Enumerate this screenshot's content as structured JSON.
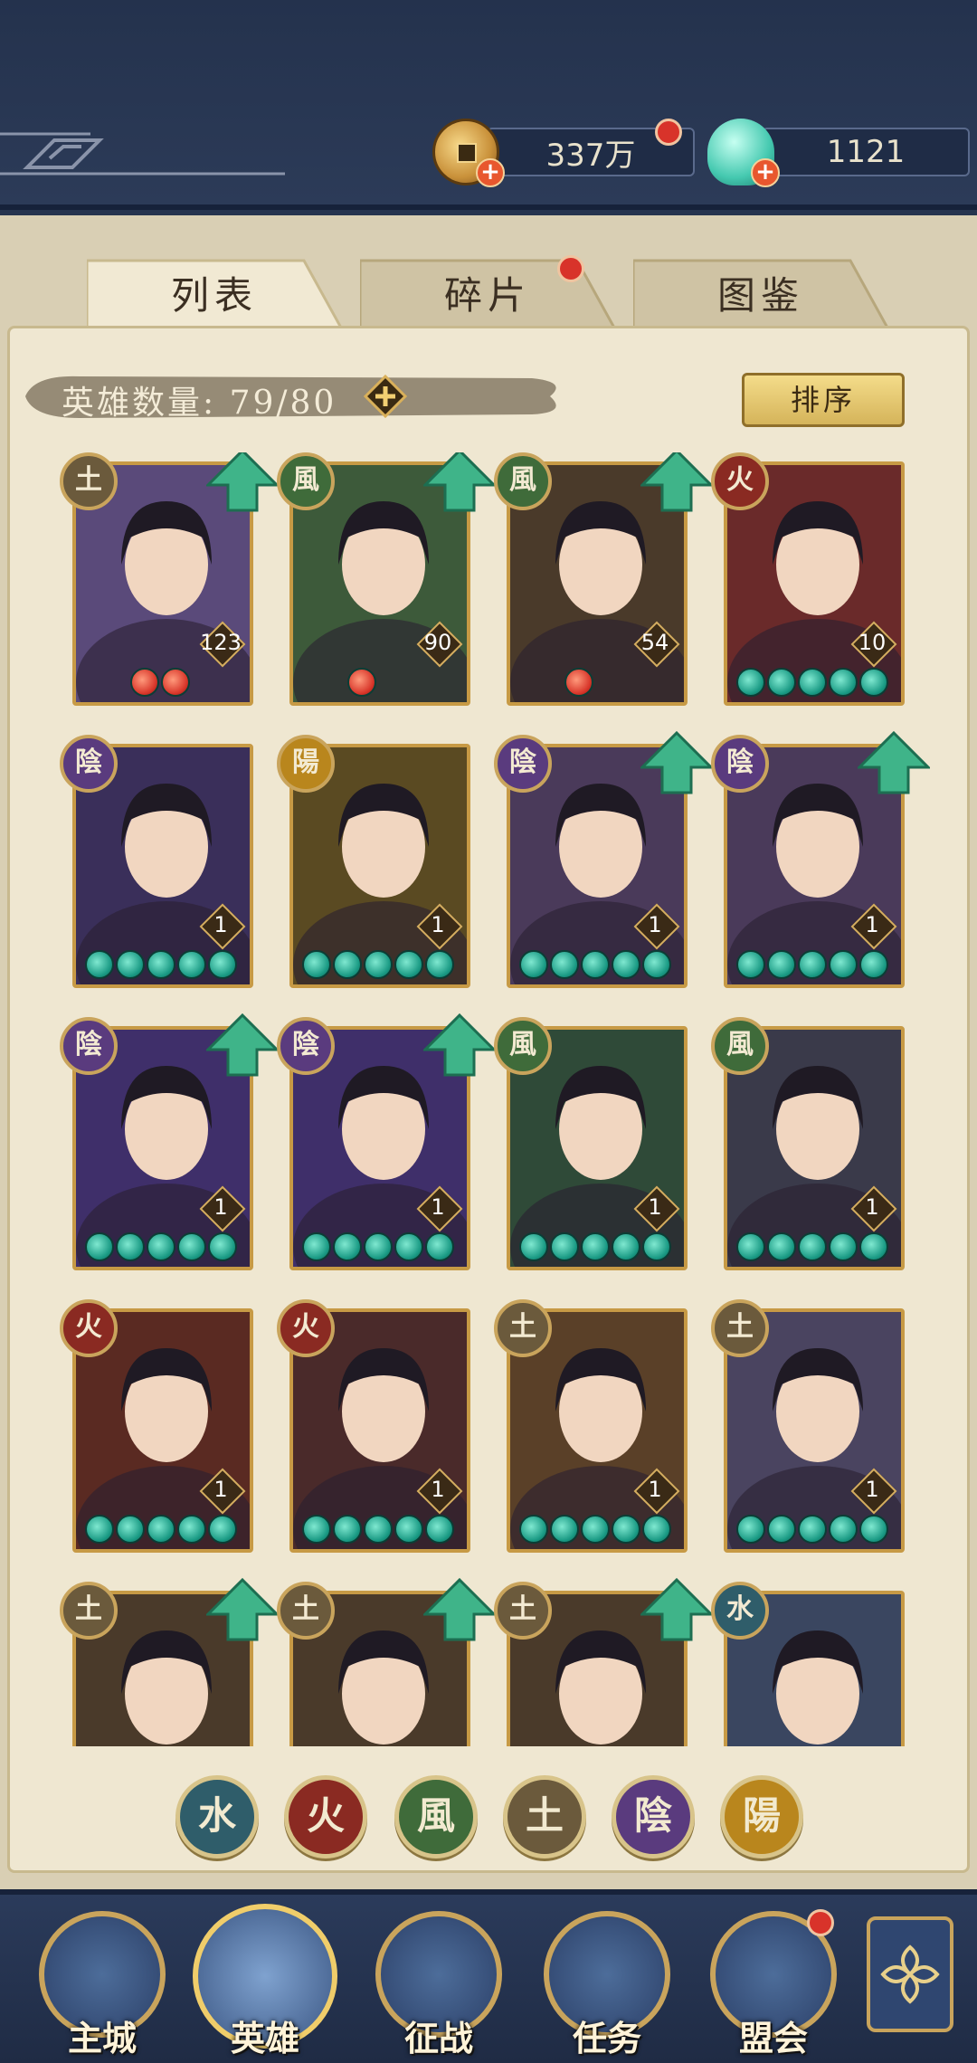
{
  "currency": {
    "coins": "337万",
    "jade": "1121"
  },
  "tabs": [
    {
      "label": "列表"
    },
    {
      "label": "碎片"
    },
    {
      "label": "图鉴"
    }
  ],
  "hero_count": {
    "label": "英雄数量:  79/80"
  },
  "sort_button": "排序",
  "elements": {
    "earth": "土",
    "wind": "風",
    "fire": "火",
    "yin": "陰",
    "yang": "陽",
    "water": "水"
  },
  "heroes": [
    {
      "element": "土",
      "level": "123",
      "stars": 2,
      "star_color": "red",
      "upgrade": true
    },
    {
      "element": "風",
      "level": "90",
      "stars": 1,
      "star_color": "red",
      "upgrade": true
    },
    {
      "element": "風",
      "level": "54",
      "stars": 1,
      "star_color": "red",
      "upgrade": true
    },
    {
      "element": "火",
      "level": "10",
      "stars": 5,
      "star_color": "teal",
      "upgrade": false
    },
    {
      "element": "陰",
      "level": "1",
      "stars": 5,
      "star_color": "teal",
      "upgrade": false
    },
    {
      "element": "陽",
      "level": "1",
      "stars": 5,
      "star_color": "teal",
      "upgrade": false
    },
    {
      "element": "陰",
      "level": "1",
      "stars": 5,
      "star_color": "teal",
      "upgrade": true
    },
    {
      "element": "陰",
      "level": "1",
      "stars": 5,
      "star_color": "teal",
      "upgrade": true
    },
    {
      "element": "陰",
      "level": "1",
      "stars": 5,
      "star_color": "teal",
      "upgrade": true
    },
    {
      "element": "陰",
      "level": "1",
      "stars": 5,
      "star_color": "teal",
      "upgrade": true
    },
    {
      "element": "風",
      "level": "1",
      "stars": 5,
      "star_color": "teal",
      "upgrade": false
    },
    {
      "element": "風",
      "level": "1",
      "stars": 5,
      "star_color": "teal",
      "upgrade": false
    },
    {
      "element": "火",
      "level": "1",
      "stars": 5,
      "star_color": "teal",
      "upgrade": false
    },
    {
      "element": "火",
      "level": "1",
      "stars": 5,
      "star_color": "teal",
      "upgrade": false
    },
    {
      "element": "土",
      "level": "1",
      "stars": 5,
      "star_color": "teal",
      "upgrade": false
    },
    {
      "element": "土",
      "level": "1",
      "stars": 5,
      "star_color": "teal",
      "upgrade": false
    },
    {
      "element": "土",
      "level": "",
      "stars": 0,
      "star_color": "teal",
      "upgrade": true
    },
    {
      "element": "土",
      "level": "",
      "stars": 0,
      "star_color": "teal",
      "upgrade": true
    },
    {
      "element": "土",
      "level": "",
      "stars": 0,
      "star_color": "teal",
      "upgrade": true
    },
    {
      "element": "水",
      "level": "",
      "stars": 0,
      "star_color": "teal",
      "upgrade": false
    }
  ],
  "filters": [
    "水",
    "火",
    "風",
    "土",
    "陰",
    "陽"
  ],
  "nav": [
    {
      "label": "主城"
    },
    {
      "label": "英雄"
    },
    {
      "label": "征战"
    },
    {
      "label": "任务"
    },
    {
      "label": "盟会"
    }
  ],
  "colors": {
    "earth": "#6b5a3c",
    "wind": "#3f6b3a",
    "fire": "#8a2a22",
    "yin": "#5a3b7e",
    "yang": "#b9861d",
    "water": "#2f5d6a"
  }
}
